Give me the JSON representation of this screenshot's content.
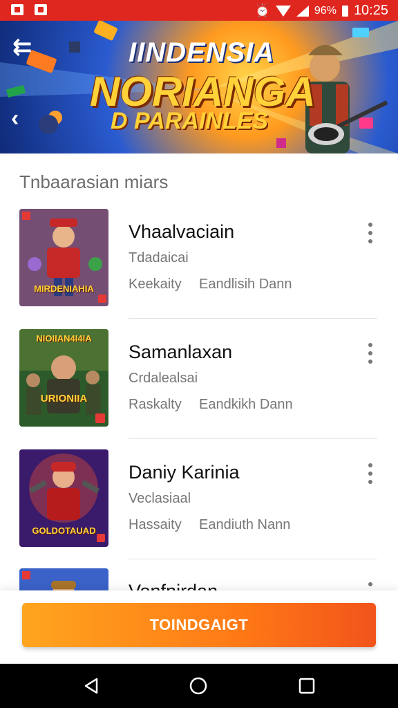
{
  "status_bar": {
    "battery_text": "96%",
    "time": "10:25"
  },
  "banner": {
    "title_line1": "IINDENSIA",
    "title_line2": "NORIANGA",
    "title_line3": "D PARAINLES"
  },
  "section_title": "Tnbaarasian miars",
  "games": [
    {
      "name": "Vhaalvaciain",
      "subtitle": "Tdadaicai",
      "meta_left": "Keekaity",
      "meta_right": "Eandlisih Dann",
      "art_caption": "MIRDENIAHIA"
    },
    {
      "name": "Samanlaxan",
      "subtitle": "Crdalealsai",
      "meta_left": "Raskalty",
      "meta_right": "Eandkikh Dann",
      "art_caption_top": "NIOIIAN4I4IA",
      "art_caption": "URIONIIA"
    },
    {
      "name": "Daniy Karinia",
      "subtitle": "Veclasiaal",
      "meta_left": "Hassaity",
      "meta_right": "Eandiuth Nann",
      "art_caption": "GOLDOTAUAD"
    },
    {
      "name": "Vonfnirdan",
      "subtitle": "",
      "meta_left": "",
      "meta_right": ""
    }
  ],
  "cta_label": "TOINDGAIGT",
  "colors": {
    "status_bar": "#e0271f",
    "cta_start": "#ffa51f",
    "cta_end": "#f2541b"
  }
}
